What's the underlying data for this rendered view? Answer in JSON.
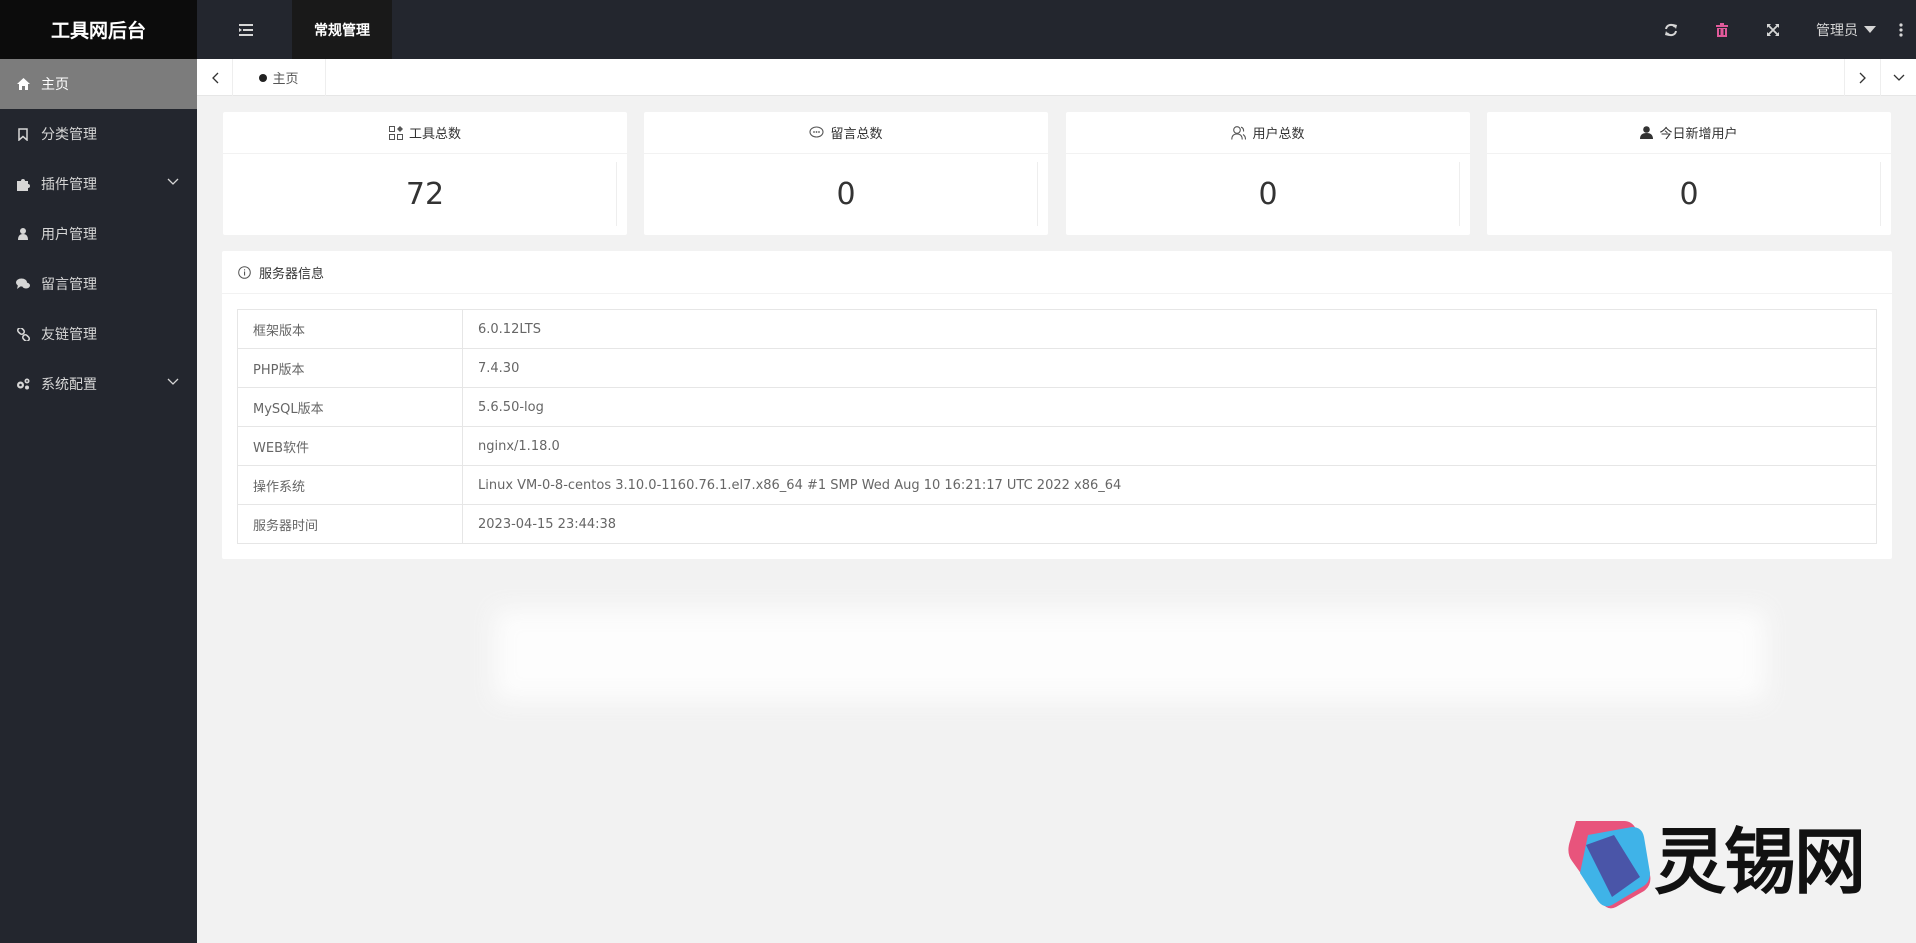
{
  "app": {
    "title": "工具网后台"
  },
  "header": {
    "active_tab": "常规管理",
    "user_label": "管理员",
    "icons": [
      "menu-toggle-icon",
      "refresh-icon",
      "trash-icon",
      "fullscreen-icon",
      "more-vertical-icon"
    ],
    "trash_color": "#e05a9a"
  },
  "sidebar": {
    "items": [
      {
        "label": "主页",
        "icon": "home-icon",
        "active": true
      },
      {
        "label": "分类管理",
        "icon": "bookmark-icon"
      },
      {
        "label": "插件管理",
        "icon": "puzzle-icon",
        "expandable": true
      },
      {
        "label": "用户管理",
        "icon": "user-icon"
      },
      {
        "label": "留言管理",
        "icon": "comments-icon"
      },
      {
        "label": "友链管理",
        "icon": "link-icon"
      },
      {
        "label": "系统配置",
        "icon": "cogs-icon",
        "expandable": true
      }
    ]
  },
  "tabbar": {
    "tabs": [
      {
        "label": "主页",
        "active": true
      }
    ]
  },
  "stats": [
    {
      "label": "工具总数",
      "value": "72",
      "icon": "apps-icon"
    },
    {
      "label": "留言总数",
      "value": "0",
      "icon": "chat-icon"
    },
    {
      "label": "用户总数",
      "value": "0",
      "icon": "users-icon"
    },
    {
      "label": "今日新增用户",
      "value": "0",
      "icon": "user-solid-icon"
    }
  ],
  "server_info": {
    "title": "服务器信息",
    "rows": [
      {
        "key": "框架版本",
        "value": "6.0.12LTS"
      },
      {
        "key": "PHP版本",
        "value": "7.4.30"
      },
      {
        "key": "MySQL版本",
        "value": "5.6.50-log"
      },
      {
        "key": "WEB软件",
        "value": "nginx/1.18.0"
      },
      {
        "key": "操作系统",
        "value": "Linux VM-0-8-centos 3.10.0-1160.76.1.el7.x86_64 #1 SMP Wed Aug 10 16:21:17 UTC 2022 x86_64"
      },
      {
        "key": "服务器时间",
        "value": "2023-04-15 23:44:38"
      }
    ]
  },
  "watermark": {
    "text": "灵锡网"
  },
  "colors": {
    "header_bg": "#23262e",
    "logo_bg": "#0c0c0c",
    "active_nav": "#7c7c7c",
    "page_bg": "#f2f2f2"
  }
}
